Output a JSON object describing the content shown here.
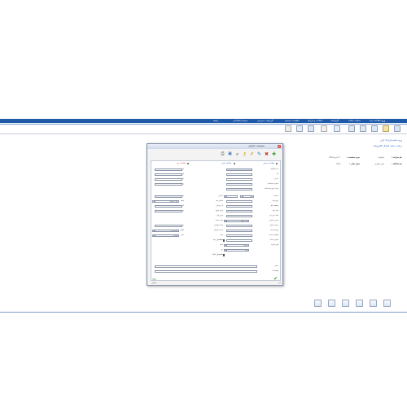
{
  "menubar": {
    "items": [
      {
        "label": "ورود اطلاعات پایه"
      },
      {
        "label": "عملیات ماهانه"
      },
      {
        "label": "گزارشات"
      },
      {
        "label": "امکانات و ابزارها"
      },
      {
        "label": "تنظیمات سیستم"
      },
      {
        "label": "گزارشات مدیریتی"
      },
      {
        "label": "سیستم اطلاعاتی"
      },
      {
        "label": "راهنما"
      }
    ]
  },
  "info_panel": {
    "link1": "ورود سابقه قرارداد کاری",
    "link2": "دریافت سابقه اشتغال الکترونیکی",
    "col1": [
      {
        "label": "نام شرکت :",
        "value": "شرکت ۱"
      },
      {
        "label": "نام کارگاه :",
        "value": "دفتر مرکزی"
      }
    ],
    "col2": [
      {
        "label": "دوره محاسبه :",
        "value": "۳۱ خرداد ۱۳۹۸"
      },
      {
        "label": "سال مالی :",
        "value": "۱۳۹۸"
      }
    ]
  },
  "dialog": {
    "title": "مشخصات کارکنان",
    "close": "×",
    "toolbar_icons": [
      "add-icon",
      "delete-icon",
      "edit-icon",
      "save-icon",
      "key-icon",
      "search-icon",
      "user-card-icon",
      "print-icon"
    ],
    "tabs": {
      "section1": "اطلاعات شخصی",
      "section2": "اطلاعات کاری",
      "section3": "اطلاعات بیمه"
    },
    "right_labels": [
      "نام خانوادگی",
      "نام",
      "نام پدر",
      "شماره شناسنامه",
      "محل صدور شناسنامه",
      "جنسیت",
      "تاریخ تولد",
      "وضعیت تاهل",
      "محل تولد",
      "تعداد فرزندان",
      "مدرک تحصیلی",
      "رشته تحصیلی",
      "نوع استخدام",
      "وضعیت خدمت",
      "شماره حساب",
      "تلفن همراه"
    ],
    "middle_labels": [
      "کد ملی",
      "شماره بیمه",
      "کد پرسنلی",
      "تاریخ شروع",
      "تاریخ پایان",
      "محل خدمت",
      "واحد سازمانی",
      "پست سازمانی",
      "بانک",
      "شعبه",
      "ملیت",
      "دین",
      "مذهب",
      "گروه خونی",
      "وضعیت",
      "مالیات"
    ],
    "left_labels": [
      "تاریخ ورود",
      "تاریخ خروج",
      "ساعت کار",
      "روز کاری",
      "شماره",
      "شعبه",
      "کد",
      "نوع",
      "بیمه",
      "مالیات",
      "سایر"
    ],
    "gender_value": "مذکر",
    "education_value": "لیسانس",
    "service_value": "پایان خدمت",
    "insurance_value": "تامین اجتماعی",
    "unit_value": "واحد مرکزی",
    "address_label": "نشانی",
    "description_label": "توضیحات",
    "check_insurance": "مشمول بیمه",
    "check_tax": "مشمول مالیات",
    "ok_button": "تایید",
    "cancel_button": "انصراف"
  },
  "bottom_toolbar": {
    "icons": [
      "export-icon",
      "monitor-icon",
      "calculator-icon",
      "report-icon",
      "settings-icon",
      "exit-icon"
    ]
  },
  "colors": {
    "menubar": "#1f5aa8",
    "link": "#1f4fb8",
    "dialog_bg": "#f3f3f3"
  }
}
